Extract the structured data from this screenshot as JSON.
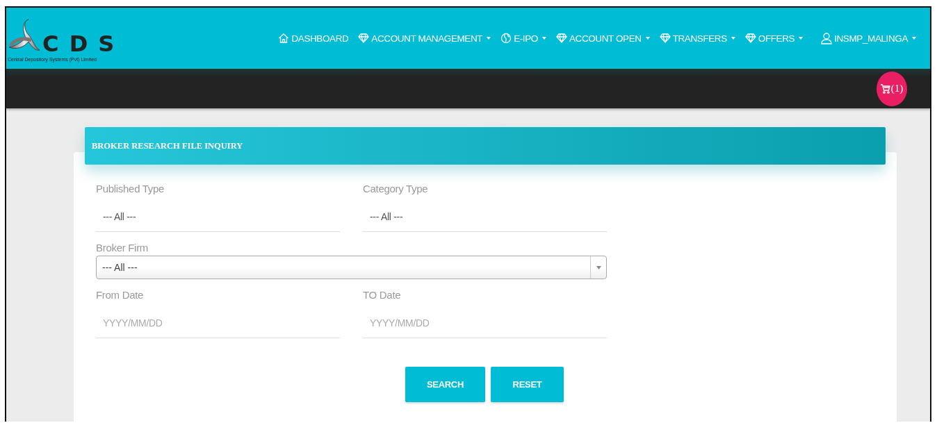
{
  "logo": {
    "letters": "C D S",
    "tagline": "Central Depository Systems (Pvt) Limited"
  },
  "nav": [
    {
      "label": "DASHBOARD",
      "kind": "home",
      "dropdown": false
    },
    {
      "label": "ACCOUNT MANAGEMENT",
      "kind": "diamond",
      "dropdown": true
    },
    {
      "label": "E-IPO",
      "kind": "globe",
      "dropdown": true
    },
    {
      "label": "ACCOUNT OPEN",
      "kind": "diamond",
      "dropdown": true
    },
    {
      "label": "TRANSFERS",
      "kind": "diamond",
      "dropdown": true
    },
    {
      "label": "OFFERS",
      "kind": "diamond",
      "dropdown": true
    },
    {
      "label": "INSMP_MALINGA",
      "kind": "user",
      "dropdown": true
    }
  ],
  "cart": {
    "count": "(1)"
  },
  "panel": {
    "title": "BROKER RESEARCH FILE INQUIRY"
  },
  "fields": [
    {
      "label": "Published Type",
      "kind": "select",
      "value": "--- All ---"
    },
    {
      "label": "Category Type",
      "kind": "select",
      "value": "--- All ---"
    },
    {
      "label": "Broker Firm",
      "kind": "combo",
      "value": "--- All ---"
    },
    {
      "label": "From Date",
      "kind": "date",
      "placeholder": "YYYY/MM/DD"
    },
    {
      "label": "TO Date",
      "kind": "date",
      "placeholder": "YYYY/MM/DD"
    }
  ],
  "buttons": [
    "SEARCH",
    "RESET"
  ]
}
